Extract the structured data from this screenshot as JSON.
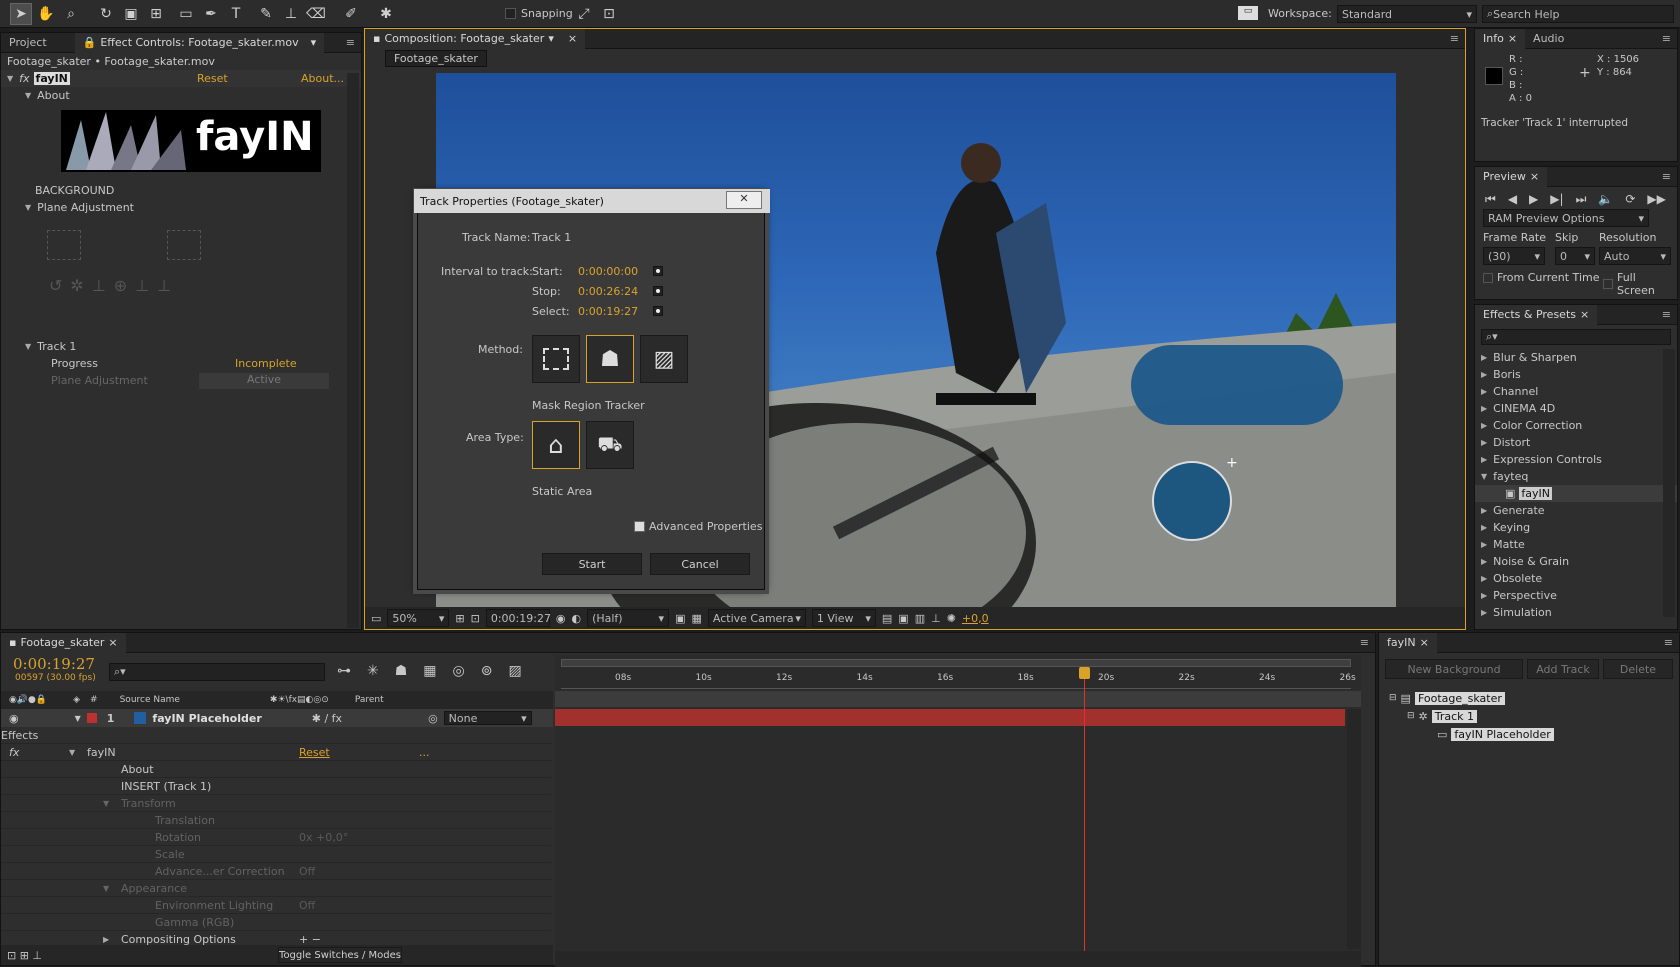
{
  "toolbar": {
    "snapping": "Snapping",
    "workspace_label": "Workspace:",
    "workspace_value": "Standard",
    "search": "Search Help"
  },
  "project_panel": {
    "tab_project": "Project",
    "tab_effect_controls": "Effect Controls: Footage_skater.mov",
    "breadcrumb": "Footage_skater • Footage_skater.mov",
    "fx_name": "fayIN",
    "reset": "Reset",
    "about": "About...",
    "about_row": "About",
    "logo_text": "fayIN",
    "background": "BACKGROUND",
    "plane_adjustment": "Plane Adjustment",
    "track": "Track 1",
    "progress_label": "Progress",
    "progress_value": "Incomplete",
    "plane_adj_label": "Plane Adjustment",
    "plane_adj_value": "Active"
  },
  "composition": {
    "tab": "Composition: Footage_skater",
    "subtab": "Footage_skater",
    "zoom": "50%",
    "timecode": "0:00:19:27",
    "resolution": "(Half)",
    "camera": "Active Camera",
    "views": "1 View",
    "exposure": "+0,0"
  },
  "dialog": {
    "title": "Track Properties (Footage_skater)",
    "track_name_label": "Track Name:",
    "track_name": "Track 1",
    "interval_label": "Interval to track:",
    "start_label": "Start:",
    "start": "0:00:00:00",
    "stop_label": "Stop:",
    "stop": "0:00:26:24",
    "select_label": "Select:",
    "select": "0:00:19:27",
    "method_label": "Method:",
    "method_value": "Mask Region Tracker",
    "area_label": "Area Type:",
    "area_value": "Static Area",
    "advanced": "Advanced Properties",
    "start_btn": "Start",
    "cancel_btn": "Cancel"
  },
  "info": {
    "tab_info": "Info",
    "tab_audio": "Audio",
    "r": "R :",
    "g": "G :",
    "b": "B :",
    "a": "A : 0",
    "x": "X : 1506",
    "y": "Y : 864",
    "message": "Tracker 'Track 1' interrupted"
  },
  "preview": {
    "tab": "Preview",
    "ram": "RAM Preview Options",
    "frame_rate": "Frame Rate",
    "skip": "Skip",
    "resolution": "Resolution",
    "fr_val": "(30)",
    "skip_val": "0",
    "res_val": "Auto",
    "from_current": "From Current Time",
    "full_screen": "Full Screen"
  },
  "effects": {
    "tab": "Effects & Presets",
    "items": [
      "Blur & Sharpen",
      "Boris",
      "Channel",
      "CINEMA 4D",
      "Color Correction",
      "Distort",
      "Expression Controls",
      "fayteq",
      "fayIN",
      "Generate",
      "Keying",
      "Matte",
      "Noise & Grain",
      "Obsolete",
      "Perspective",
      "Simulation"
    ]
  },
  "timeline": {
    "tab": "Footage_skater",
    "timecode": "0:00:19:27",
    "frames": "00597 (30.00 fps)",
    "col_num": "#",
    "col_source": "Source Name",
    "col_parent": "Parent",
    "layer_num": "1",
    "layer_name": "fayIN Placeholder",
    "parent_val": "None",
    "rows": [
      {
        "t": "Effects",
        "ind": 1
      },
      {
        "t": "fayIN",
        "ind": 2,
        "reset": "Reset",
        "dots": "..."
      },
      {
        "t": "About",
        "ind": 3
      },
      {
        "t": "INSERT  (Track 1)",
        "ind": 3
      },
      {
        "t": "Transform",
        "ind": 3,
        "dim": true
      },
      {
        "t": "Translation",
        "ind": 4,
        "dim": true
      },
      {
        "t": "Rotation",
        "ind": 4,
        "dim": true,
        "v": "0x +0,0°"
      },
      {
        "t": "Scale",
        "ind": 4,
        "dim": true
      },
      {
        "t": "Advance...er Correction",
        "ind": 4,
        "dim": true,
        "v": "Off"
      },
      {
        "t": "Appearance",
        "ind": 3,
        "dim": true
      },
      {
        "t": "Environment Lighting",
        "ind": 4,
        "dim": true,
        "v": "Off"
      },
      {
        "t": "Gamma (RGB)",
        "ind": 4,
        "dim": true
      },
      {
        "t": "Compositing Options",
        "ind": 3
      }
    ],
    "toggle": "Toggle Switches / Modes",
    "ticks": [
      "08s",
      "10s",
      "12s",
      "14s",
      "16s",
      "18s",
      "20s",
      "22s",
      "24s",
      "26s"
    ]
  },
  "fayin_panel": {
    "tab": "fayIN",
    "new_bg": "New Background",
    "add_track": "Add Track",
    "delete": "Delete",
    "tree": [
      "Footage_skater",
      "Track 1",
      "fayIN Placeholder"
    ]
  }
}
